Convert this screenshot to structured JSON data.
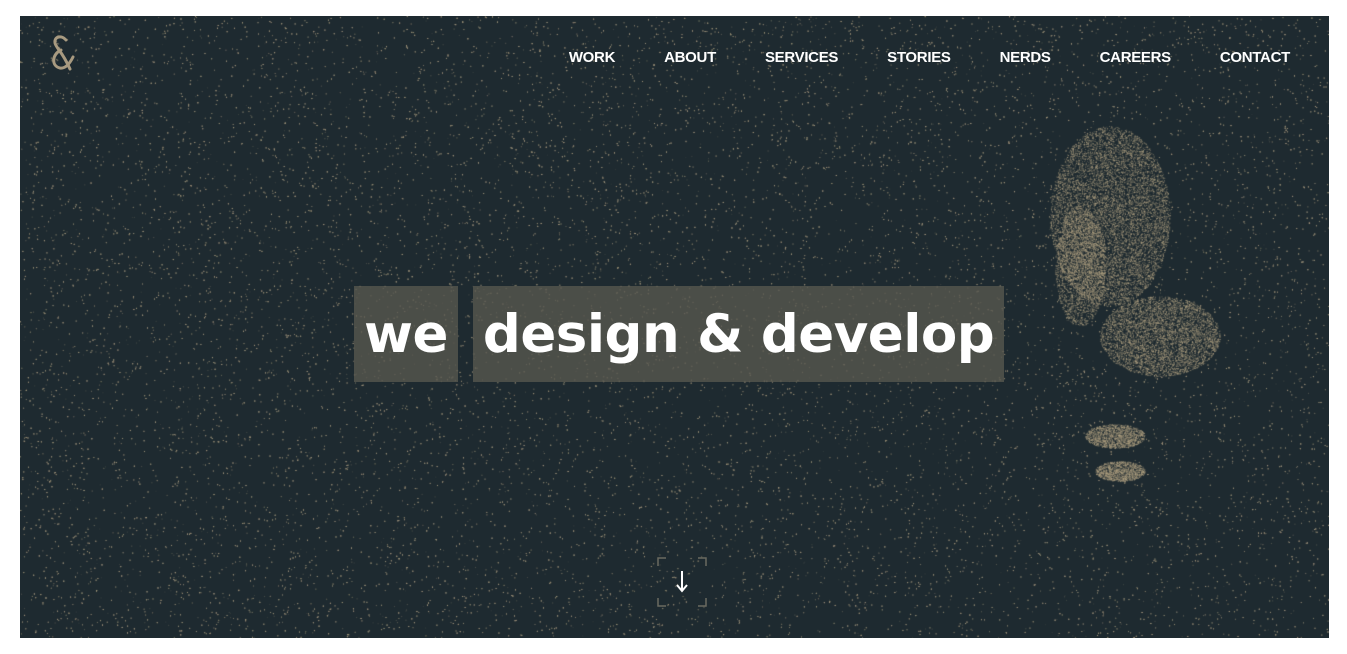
{
  "brand": {
    "logo_icon": "ampersand-logo-icon",
    "accent_color": "#a89a80"
  },
  "nav": {
    "items": [
      {
        "label": "WORK"
      },
      {
        "label": "ABOUT"
      },
      {
        "label": "SERVICES"
      },
      {
        "label": "STORIES"
      },
      {
        "label": "NERDS"
      },
      {
        "label": "CAREERS"
      },
      {
        "label": "CONTACT"
      }
    ]
  },
  "hero": {
    "word_1": "we",
    "word_2": "design & develop"
  },
  "scroll": {
    "icon": "arrow-down-icon"
  },
  "colors": {
    "background": "#1e2a30",
    "text": "#ffffff",
    "highlight": "#585850"
  }
}
